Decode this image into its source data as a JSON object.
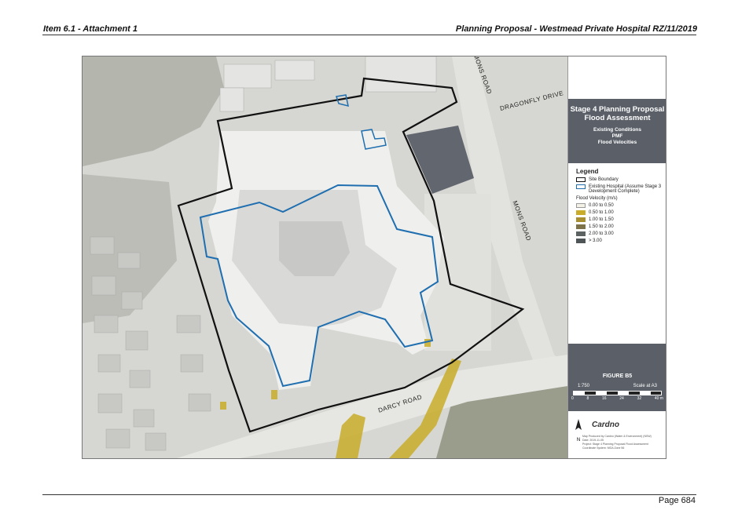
{
  "header": {
    "left": "Item 6.1 - Attachment 1",
    "right": "Planning Proposal - Westmead Private Hospital RZ/11/2019"
  },
  "footer": {
    "page": "Page 684"
  },
  "map": {
    "roads": {
      "mons_road_top": "MONS ROAD",
      "dragonfly_drive": "DRAGONFLY DRIVE",
      "mons_road_right": "MONS ROAD",
      "darcy_road": "DARCY ROAD"
    },
    "colors": {
      "site_boundary": "#111111",
      "existing_hospital": "#1f6fb0",
      "flood_low": "#c9ad2a"
    }
  },
  "panel": {
    "title": "Stage 4 Planning Proposal Flood Assessment",
    "subtitle_1": "Existing Conditions",
    "subtitle_2": "PMF",
    "subtitle_3": "Flood Velocities",
    "legend": {
      "title": "Legend",
      "site_boundary": "Site Boundary",
      "existing_hospital": "Existing Hospital (Assume Stage 3 Development Complete)",
      "velocity_title": "Flood Velocity (m/s)",
      "items": [
        {
          "label": "0.00 to 0.50",
          "color": "#f4f2e6"
        },
        {
          "label": "0.50 to 1.00",
          "color": "#c9ad2a"
        },
        {
          "label": "1.00 to 1.50",
          "color": "#a88f30"
        },
        {
          "label": "1.50 to 2.00",
          "color": "#7e7348"
        },
        {
          "label": "2.00 to 3.00",
          "color": "#5c6262"
        },
        {
          "label": "> 3.00",
          "color": "#4f5456"
        }
      ]
    },
    "figure": "FIGURE B5",
    "scale_ratio": "1:750",
    "scale_note": "Scale at A3",
    "scale_ticks": [
      "0",
      "8",
      "16",
      "24",
      "32",
      "40 m"
    ],
    "logo": "Cardno",
    "north": "N",
    "fine_print": [
      "Map Produced by Cardno (Water & Environment) (NSW)",
      "Date: 2019-11-05",
      "Project: Stage 4 Planning Proposal Flood Assessment",
      "Coordinate System: MGA Zone 56"
    ]
  }
}
